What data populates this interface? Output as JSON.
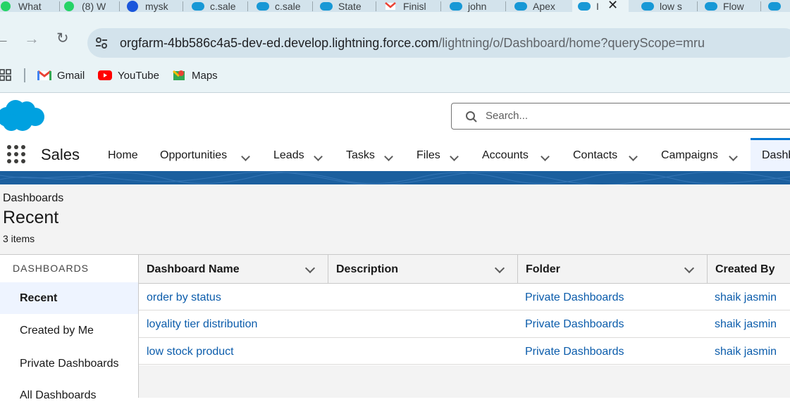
{
  "browser": {
    "tabs": [
      {
        "label": "What",
        "icon": "whatsapp-icon"
      },
      {
        "label": "(8) W",
        "icon": "whatsapp-icon"
      },
      {
        "label": "mysk",
        "icon": "sw-icon"
      },
      {
        "label": "c.sale",
        "icon": "salesforce-icon"
      },
      {
        "label": "c.sale",
        "icon": "salesforce-icon"
      },
      {
        "label": "State",
        "icon": "salesforce-icon"
      },
      {
        "label": "Finisl",
        "icon": "gmail-icon"
      },
      {
        "label": "john",
        "icon": "salesforce-icon"
      },
      {
        "label": "Apex",
        "icon": "salesforce-icon"
      },
      {
        "label": "I",
        "icon": "salesforce-icon",
        "active": true
      },
      {
        "label": "low s",
        "icon": "salesforce-icon"
      },
      {
        "label": "Flow",
        "icon": "salesforce-icon"
      }
    ],
    "url_host": "orgfarm-4bb586c4a5-dev-ed.develop.lightning.force.com",
    "url_path": "/lightning/o/Dashboard/home?queryScope=mru",
    "bookmarks": [
      {
        "label": "Gmail",
        "icon": "gmail-icon"
      },
      {
        "label": "YouTube",
        "icon": "youtube-icon"
      },
      {
        "label": "Maps",
        "icon": "maps-icon"
      }
    ]
  },
  "header": {
    "search_placeholder": "Search...",
    "app_name": "Sales",
    "nav": [
      {
        "label": "Home"
      },
      {
        "label": "Opportunities"
      },
      {
        "label": "Leads"
      },
      {
        "label": "Tasks"
      },
      {
        "label": "Files"
      },
      {
        "label": "Accounts"
      },
      {
        "label": "Contacts"
      },
      {
        "label": "Campaigns"
      },
      {
        "label": "Dashb"
      }
    ]
  },
  "page": {
    "breadcrumb": "Dashboards",
    "title": "Recent",
    "count": "3 items"
  },
  "sidebar": {
    "heading": "DASHBOARDS",
    "items": [
      "Recent",
      "Created by Me",
      "Private Dashboards",
      "All Dashboards"
    ]
  },
  "table": {
    "columns": [
      "Dashboard Name",
      "Description",
      "Folder",
      "Created By"
    ],
    "rows": [
      {
        "name": "order by status",
        "description": "",
        "folder": "Private Dashboards",
        "created_by": "shaik jasmin"
      },
      {
        "name": "loyality tier distribution",
        "description": "",
        "folder": "Private Dashboards",
        "created_by": "shaik jasmin"
      },
      {
        "name": "low stock product",
        "description": "",
        "folder": "Private Dashboards",
        "created_by": "shaik jasmin"
      }
    ]
  },
  "colors": {
    "brand_blue": "#0176d3",
    "link": "#0b5cab",
    "banner": "#1b5f9e"
  }
}
